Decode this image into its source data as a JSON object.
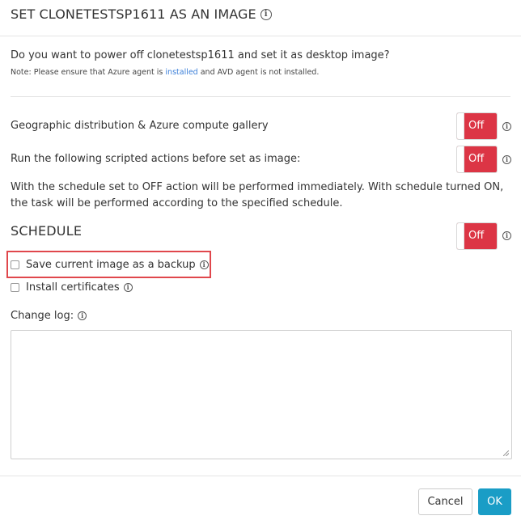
{
  "dialog": {
    "title": "SET CLONETESTSP1611 AS AN IMAGE",
    "question": "Do you want to power off clonetestsp1611 and set it as desktop image?",
    "note": {
      "prefix": "Note: Please ensure that Azure agent is ",
      "link": "installed",
      "suffix": " and AVD agent is not installed."
    },
    "options": {
      "geo_label": "Geographic distribution & Azure compute gallery",
      "geo_toggle": "Off",
      "scripted_label": "Run the following scripted actions before set as image:",
      "scripted_toggle": "Off",
      "schedule_note": "With the schedule set to OFF action will be performed immediately. With schedule turned ON, the task will be performed according to the specified schedule."
    },
    "schedule": {
      "heading": "SCHEDULE",
      "toggle": "Off"
    },
    "checkboxes": {
      "backup_label": "Save current image as a backup",
      "backup_checked": false,
      "certs_label": "Install certificates",
      "certs_checked": false
    },
    "changelog": {
      "label": "Change log:",
      "value": ""
    },
    "buttons": {
      "cancel": "Cancel",
      "ok": "OK"
    },
    "colors": {
      "toggle_off": "#dc3545",
      "primary": "#1a9dc6",
      "link": "#3b7fd9",
      "highlight": "#e0474c"
    },
    "icons": {
      "info": "info-circle-icon"
    }
  }
}
